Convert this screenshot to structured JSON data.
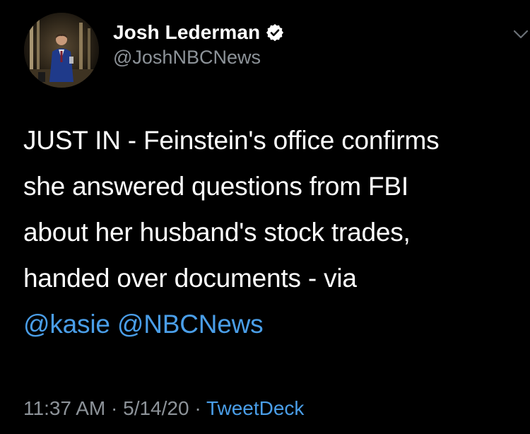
{
  "tweet": {
    "author": {
      "display_name": "Josh Lederman",
      "handle": "@JoshNBCNews",
      "verified": true,
      "avatar_icon": "profile-photo"
    },
    "text_lines": [
      "JUST IN - Feinstein's office confirms",
      "she answered questions from FBI",
      "about her husband's stock trades,",
      "handed over documents - via"
    ],
    "mentions": [
      "@kasie",
      "@NBCNews"
    ],
    "time": "11:37 AM",
    "separator": "·",
    "date": "5/14/20",
    "source": "TweetDeck"
  },
  "colors": {
    "background": "#000000",
    "text": "#ffffff",
    "secondary": "#8d9399",
    "link": "#4a9ee8"
  },
  "icons": {
    "verified": "verified-badge-icon",
    "menu": "chevron-down-icon"
  }
}
